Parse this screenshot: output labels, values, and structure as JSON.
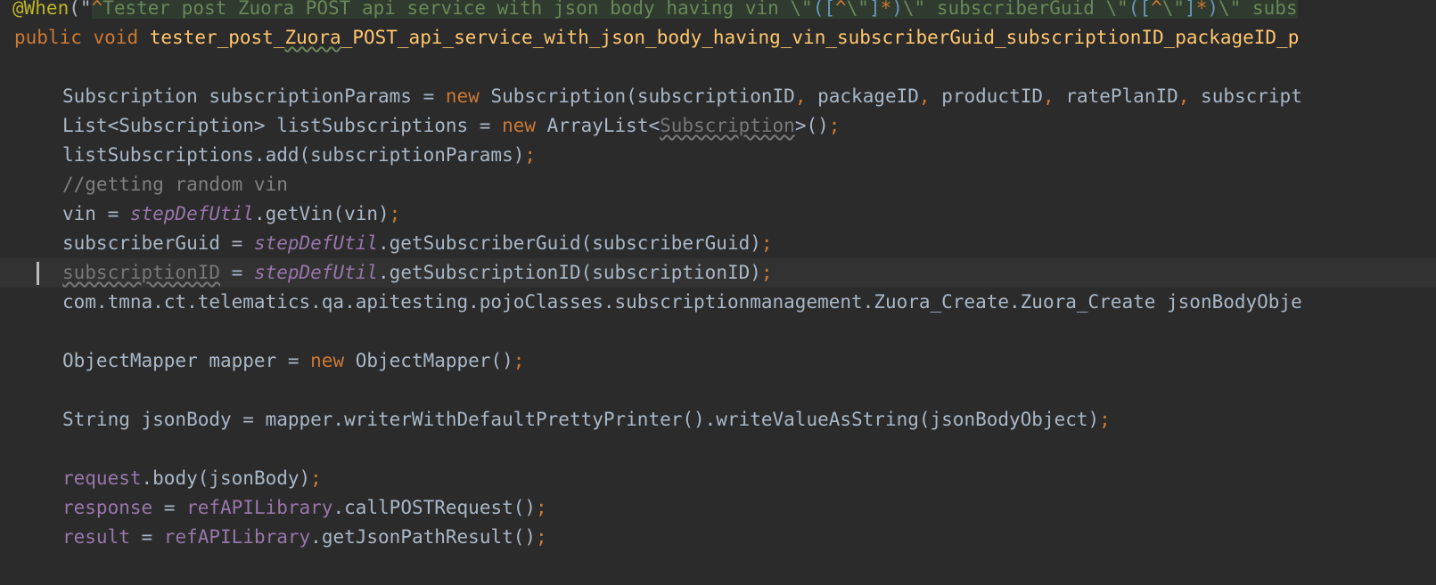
{
  "editor": {
    "line1": {
      "annotation": "@When",
      "p_open": "(\"",
      "caret": "^",
      "s1": "Tester post Zuora POST api service with json body having vin \\\"",
      "g_open": "([",
      "neg": "^",
      "s2": "\\\"",
      "g_close": "]",
      "star": "*",
      "g_paren": ")",
      "s3": "\\\" subscriberGuid \\\"",
      "g_open2": "([",
      "neg2": "^",
      "s4": "\\\"",
      "g_close2": "]",
      "star2": "*",
      "g_paren2": ")",
      "s5": "\\\" subs"
    },
    "line2": {
      "kw_public": "public",
      "kw_void": "void",
      "m1": "tester_post_",
      "m_zuora": "Zuora",
      "m2": "_POST_api_service_with_json_body_having_vin_subscriberGuid_subscriptionID_packageID_p"
    },
    "line3": {
      "a": "Subscription subscriptionParams = ",
      "kw_new": "new",
      "b": " Subscription(subscriptionID",
      "c1": ",",
      "d": " packageID",
      "c2": ",",
      "e": " productID",
      "c3": ",",
      "f": " ratePlanID",
      "c4": ",",
      "g": " subscript"
    },
    "line4": {
      "a": "List<Subscription> listSubscriptions = ",
      "kw_new": "new",
      "b": " ArrayList<",
      "c": "Subscription",
      "d": ">()",
      "semi": ";"
    },
    "line5": {
      "a": "listSubscriptions.add(subscriptionParams)",
      "semi": ";"
    },
    "line6": {
      "comment": "//getting random vin"
    },
    "line7": {
      "a": "vin = ",
      "util": "stepDefUtil",
      "b": ".getVin(vin)",
      "semi": ";"
    },
    "line8": {
      "a": "subscriberGuid = ",
      "util": "stepDefUtil",
      "b": ".getSubscriberGuid(subscriberGuid)",
      "semi": ";"
    },
    "line9": {
      "a": "subscriptionID",
      "b": " = ",
      "util": "stepDefUtil",
      "c": ".getSubscriptionID(subscriptionID)",
      "semi": ";"
    },
    "line10": {
      "a": "com.tmna.ct.telematics.qa.apitesting.pojoClasses.subscriptionmanagement.Zuora_Create.Zuora_Create jsonBodyObje"
    },
    "line11": {
      "a": "ObjectMapper mapper = ",
      "kw_new": "new",
      "b": " ObjectMapper()",
      "semi": ";"
    },
    "line12": {
      "a": "String jsonBody = mapper.writerWithDefaultPrettyPrinter().writeValueAsString(jsonBodyObject)",
      "semi": ";"
    },
    "line13": {
      "fld": "request",
      "a": ".body(jsonBody)",
      "semi": ";"
    },
    "line14": {
      "fld": "response",
      "a": " = ",
      "fld2": "refAPILibrary",
      "b": ".callPOSTRequest()",
      "semi": ";"
    },
    "line15": {
      "fld": "result",
      "a": " = ",
      "fld2": "refAPILibrary",
      "b": ".getJsonPathResult()",
      "semi": ";"
    }
  }
}
